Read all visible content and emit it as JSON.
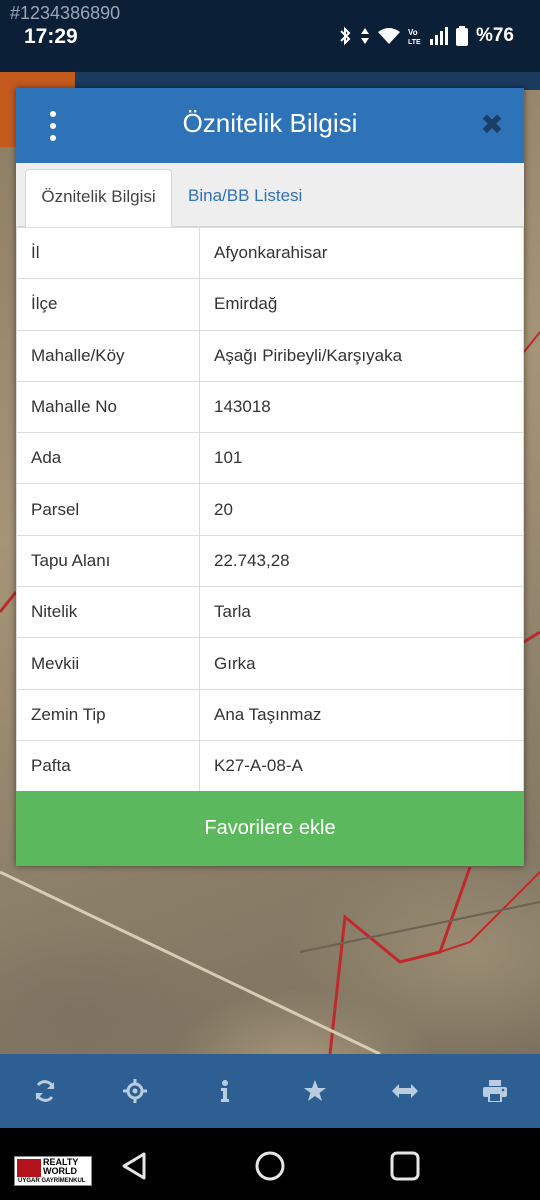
{
  "status_bar": {
    "watermark_id": "#1234386890",
    "time": "17:29",
    "battery": "%76"
  },
  "modal": {
    "title": "Öznitelik Bilgisi",
    "close_glyph": "✖",
    "tabs": [
      {
        "label": "Öznitelik Bilgisi",
        "active": true
      },
      {
        "label": "Bina/BB Listesi",
        "active": false
      }
    ],
    "rows": [
      {
        "key": "İl",
        "value": "Afyonkarahisar"
      },
      {
        "key": "İlçe",
        "value": "Emirdağ"
      },
      {
        "key": "Mahalle/Köy",
        "value": "Aşağı Piribeyli/Karşıyaka"
      },
      {
        "key": "Mahalle No",
        "value": "143018"
      },
      {
        "key": "Ada",
        "value": "101"
      },
      {
        "key": "Parsel",
        "value": "20"
      },
      {
        "key": "Tapu Alanı",
        "value": "22.743,28"
      },
      {
        "key": "Nitelik",
        "value": "Tarla"
      },
      {
        "key": "Mevkii",
        "value": "Gırka"
      },
      {
        "key": "Zemin Tip",
        "value": "Ana Taşınmaz"
      },
      {
        "key": "Pafta",
        "value": "K27-A-08-A"
      }
    ],
    "favorite_label": "Favorilere ekle"
  },
  "toolbar": {
    "items": [
      "refresh-icon",
      "locate-icon",
      "info-icon",
      "star-icon",
      "measure-icon",
      "print-icon"
    ]
  },
  "logo": {
    "line1": "REALTY",
    "line2": "WORLD",
    "sub": "UYGAR GAYRİMENKUL"
  },
  "colors": {
    "header_blue": "#2e72b8",
    "favorite_green": "#5cb85c",
    "toolbar_blue": "#2e5f92",
    "parcel_red": "#c0282d"
  }
}
